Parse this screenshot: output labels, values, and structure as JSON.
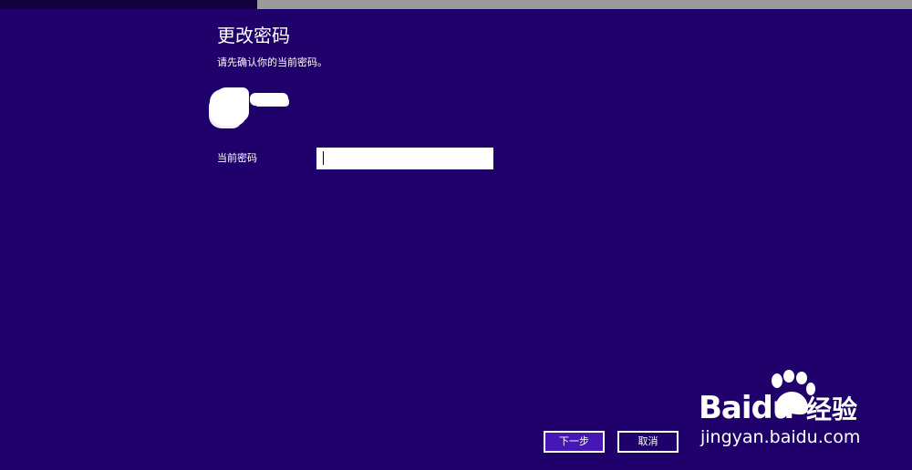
{
  "dialog": {
    "title": "更改密码",
    "subtitle": "请先确认你的当前密码。"
  },
  "form": {
    "current_password_label": "当前密码",
    "current_password_value": ""
  },
  "buttons": {
    "next_label": "下一步",
    "cancel_label": "取消"
  },
  "watermark": {
    "brand_prefix": "Bai",
    "brand_suffix": "du",
    "product": "经验",
    "url": "jingyan.baidu.com"
  },
  "colors": {
    "background": "#20006a",
    "primary_button": "#4617b4",
    "text": "#ffffff"
  }
}
